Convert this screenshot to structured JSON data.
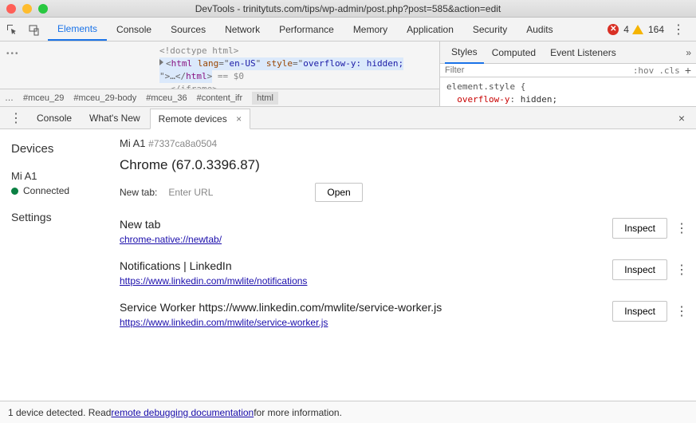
{
  "window": {
    "title": "DevTools - trinitytuts.com/tips/wp-admin/post.php?post=585&action=edit"
  },
  "toolbar": {
    "tabs": [
      "Elements",
      "Console",
      "Sources",
      "Network",
      "Performance",
      "Memory",
      "Application",
      "Security",
      "Audits"
    ],
    "active": "Elements",
    "errors": "4",
    "warnings": "164"
  },
  "dom": {
    "line1": "<!doctype html>",
    "open_tag": "html",
    "attrs": [
      [
        "lang",
        "en-US"
      ],
      [
        "style",
        "overflow-y: hidden;"
      ]
    ],
    "ellipsis": "…",
    "close_tag": "html",
    "eq": "== $0",
    "iframe_close": "</iframe>"
  },
  "breadcrumbs": [
    "…",
    "#mceu_29",
    "#mceu_29-body",
    "#mceu_36",
    "#content_ifr",
    "html"
  ],
  "styles": {
    "tabs": [
      "Styles",
      "Computed",
      "Event Listeners"
    ],
    "active": "Styles",
    "filter_placeholder": "Filter",
    "hov": ":hov",
    "cls": ".cls",
    "rule_selector": "element.style {",
    "rule_prop": "overflow-y",
    "rule_val": "hidden;"
  },
  "drawer": {
    "tabs": [
      "Console",
      "What's New",
      "Remote devices"
    ],
    "active": "Remote devices"
  },
  "sidebar": {
    "heading": "Devices",
    "device": "Mi A1",
    "status": "Connected",
    "settings": "Settings"
  },
  "device": {
    "name": "Mi A1",
    "hash": "#7337ca8a0504",
    "browser": "Chrome (67.0.3396.87)",
    "newtab_label": "New tab:",
    "enter_url": "Enter URL",
    "open": "Open",
    "inspect": "Inspect",
    "tabs": [
      {
        "title": "New tab",
        "url": "chrome-native://newtab/"
      },
      {
        "title": "Notifications | LinkedIn",
        "url": "https://www.linkedin.com/mwlite/notifications"
      },
      {
        "title": "Service Worker https://www.linkedin.com/mwlite/service-worker.js",
        "url": "https://www.linkedin.com/mwlite/service-worker.js"
      }
    ]
  },
  "footer": {
    "prefix": "1 device detected. Read ",
    "link": "remote debugging documentation",
    "suffix": " for more information."
  }
}
